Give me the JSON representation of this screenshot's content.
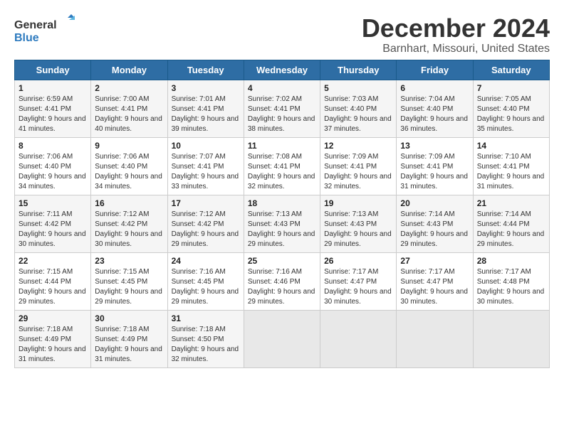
{
  "logo": {
    "general": "General",
    "blue": "Blue"
  },
  "title": "December 2024",
  "subtitle": "Barnhart, Missouri, United States",
  "days_of_week": [
    "Sunday",
    "Monday",
    "Tuesday",
    "Wednesday",
    "Thursday",
    "Friday",
    "Saturday"
  ],
  "weeks": [
    [
      {
        "day": "1",
        "sunrise": "6:59 AM",
        "sunset": "4:41 PM",
        "daylight": "9 hours and 41 minutes."
      },
      {
        "day": "2",
        "sunrise": "7:00 AM",
        "sunset": "4:41 PM",
        "daylight": "9 hours and 40 minutes."
      },
      {
        "day": "3",
        "sunrise": "7:01 AM",
        "sunset": "4:41 PM",
        "daylight": "9 hours and 39 minutes."
      },
      {
        "day": "4",
        "sunrise": "7:02 AM",
        "sunset": "4:41 PM",
        "daylight": "9 hours and 38 minutes."
      },
      {
        "day": "5",
        "sunrise": "7:03 AM",
        "sunset": "4:40 PM",
        "daylight": "9 hours and 37 minutes."
      },
      {
        "day": "6",
        "sunrise": "7:04 AM",
        "sunset": "4:40 PM",
        "daylight": "9 hours and 36 minutes."
      },
      {
        "day": "7",
        "sunrise": "7:05 AM",
        "sunset": "4:40 PM",
        "daylight": "9 hours and 35 minutes."
      }
    ],
    [
      {
        "day": "8",
        "sunrise": "7:06 AM",
        "sunset": "4:40 PM",
        "daylight": "9 hours and 34 minutes."
      },
      {
        "day": "9",
        "sunrise": "7:06 AM",
        "sunset": "4:40 PM",
        "daylight": "9 hours and 34 minutes."
      },
      {
        "day": "10",
        "sunrise": "7:07 AM",
        "sunset": "4:41 PM",
        "daylight": "9 hours and 33 minutes."
      },
      {
        "day": "11",
        "sunrise": "7:08 AM",
        "sunset": "4:41 PM",
        "daylight": "9 hours and 32 minutes."
      },
      {
        "day": "12",
        "sunrise": "7:09 AM",
        "sunset": "4:41 PM",
        "daylight": "9 hours and 32 minutes."
      },
      {
        "day": "13",
        "sunrise": "7:09 AM",
        "sunset": "4:41 PM",
        "daylight": "9 hours and 31 minutes."
      },
      {
        "day": "14",
        "sunrise": "7:10 AM",
        "sunset": "4:41 PM",
        "daylight": "9 hours and 31 minutes."
      }
    ],
    [
      {
        "day": "15",
        "sunrise": "7:11 AM",
        "sunset": "4:42 PM",
        "daylight": "9 hours and 30 minutes."
      },
      {
        "day": "16",
        "sunrise": "7:12 AM",
        "sunset": "4:42 PM",
        "daylight": "9 hours and 30 minutes."
      },
      {
        "day": "17",
        "sunrise": "7:12 AM",
        "sunset": "4:42 PM",
        "daylight": "9 hours and 29 minutes."
      },
      {
        "day": "18",
        "sunrise": "7:13 AM",
        "sunset": "4:43 PM",
        "daylight": "9 hours and 29 minutes."
      },
      {
        "day": "19",
        "sunrise": "7:13 AM",
        "sunset": "4:43 PM",
        "daylight": "9 hours and 29 minutes."
      },
      {
        "day": "20",
        "sunrise": "7:14 AM",
        "sunset": "4:43 PM",
        "daylight": "9 hours and 29 minutes."
      },
      {
        "day": "21",
        "sunrise": "7:14 AM",
        "sunset": "4:44 PM",
        "daylight": "9 hours and 29 minutes."
      }
    ],
    [
      {
        "day": "22",
        "sunrise": "7:15 AM",
        "sunset": "4:44 PM",
        "daylight": "9 hours and 29 minutes."
      },
      {
        "day": "23",
        "sunrise": "7:15 AM",
        "sunset": "4:45 PM",
        "daylight": "9 hours and 29 minutes."
      },
      {
        "day": "24",
        "sunrise": "7:16 AM",
        "sunset": "4:45 PM",
        "daylight": "9 hours and 29 minutes."
      },
      {
        "day": "25",
        "sunrise": "7:16 AM",
        "sunset": "4:46 PM",
        "daylight": "9 hours and 29 minutes."
      },
      {
        "day": "26",
        "sunrise": "7:17 AM",
        "sunset": "4:47 PM",
        "daylight": "9 hours and 30 minutes."
      },
      {
        "day": "27",
        "sunrise": "7:17 AM",
        "sunset": "4:47 PM",
        "daylight": "9 hours and 30 minutes."
      },
      {
        "day": "28",
        "sunrise": "7:17 AM",
        "sunset": "4:48 PM",
        "daylight": "9 hours and 30 minutes."
      }
    ],
    [
      {
        "day": "29",
        "sunrise": "7:18 AM",
        "sunset": "4:49 PM",
        "daylight": "9 hours and 31 minutes."
      },
      {
        "day": "30",
        "sunrise": "7:18 AM",
        "sunset": "4:49 PM",
        "daylight": "9 hours and 31 minutes."
      },
      {
        "day": "31",
        "sunrise": "7:18 AM",
        "sunset": "4:50 PM",
        "daylight": "9 hours and 32 minutes."
      },
      null,
      null,
      null,
      null
    ]
  ],
  "labels": {
    "sunrise": "Sunrise:",
    "sunset": "Sunset:",
    "daylight": "Daylight:"
  }
}
